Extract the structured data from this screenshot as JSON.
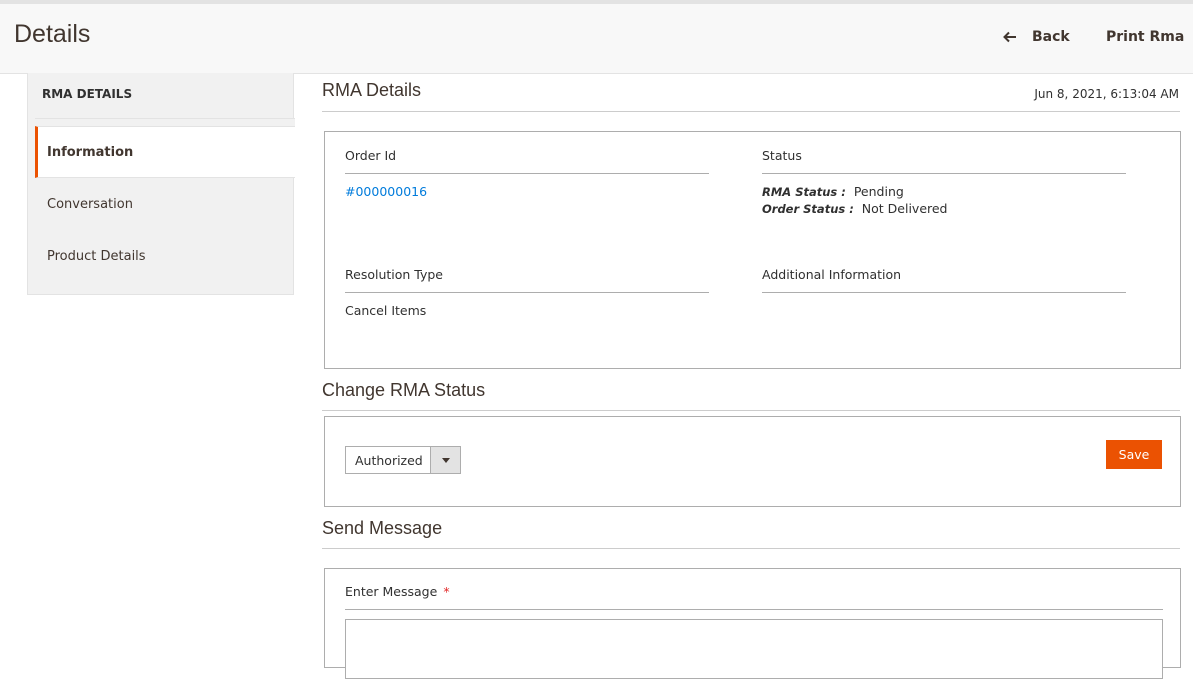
{
  "header": {
    "title": "Details",
    "back_label": "Back",
    "print_label": "Print Rma"
  },
  "sidebar": {
    "title": "RMA DETAILS",
    "items": [
      {
        "label": "Information",
        "active": true
      },
      {
        "label": "Conversation",
        "active": false
      },
      {
        "label": "Product Details",
        "active": false
      }
    ]
  },
  "rma_details": {
    "title": "RMA Details",
    "date": "Jun 8, 2021, 6:13:04 AM",
    "order_id_label": "Order Id",
    "order_id_value": "#000000016",
    "status_label": "Status",
    "rma_status_label": "RMA Status :",
    "rma_status_value": "Pending",
    "order_status_label": "Order Status :",
    "order_status_value": "Not Delivered",
    "resolution_label": "Resolution Type",
    "resolution_value": "Cancel Items",
    "additional_label": "Additional Information"
  },
  "change_status": {
    "title": "Change RMA Status",
    "selected": "Authorized",
    "save_label": "Save"
  },
  "send_message": {
    "title": "Send Message",
    "field_label": "Enter Message",
    "required_mark": "*"
  },
  "colors": {
    "accent": "#eb5202",
    "link": "#007bdb",
    "text": "#41362f"
  }
}
